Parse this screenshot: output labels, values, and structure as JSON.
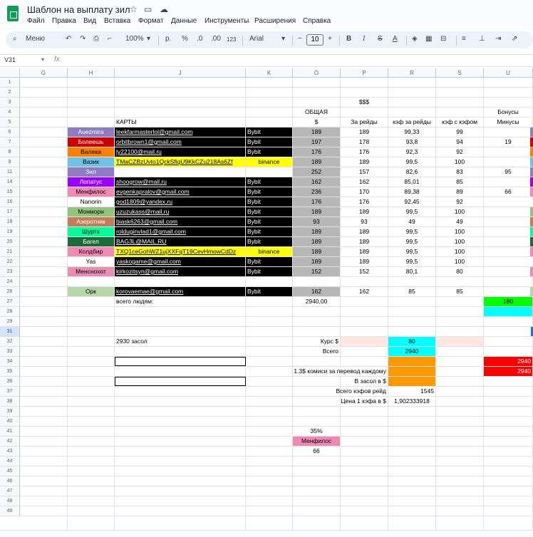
{
  "app": {
    "title": "Шаблон на выплату зил",
    "menus": [
      "Файл",
      "Правка",
      "Вид",
      "Вставка",
      "Формат",
      "Данные",
      "Инструменты",
      "Расширения",
      "Справка"
    ]
  },
  "toolbar": {
    "search_label": "Меню",
    "zoom": "100%",
    "currency": "р.",
    "percent": "%",
    "dec_less": ".0",
    "dec_more": ".00",
    "number_format": "123",
    "font": "Arial",
    "font_size": "10",
    "bold": "B",
    "italic": "I",
    "strike": "S",
    "text_color": "A",
    "minus": "−",
    "plus": "+"
  },
  "formula_bar": {
    "cell_ref": "V31",
    "fx": "fx"
  },
  "columns": [
    "",
    "G",
    "H",
    "J",
    "K",
    "O",
    "P",
    "R",
    "S",
    "U"
  ],
  "rows": [
    "1",
    "2",
    "3",
    "4",
    "5",
    "6",
    "7",
    "8",
    "9",
    "11",
    "14",
    "15",
    "16",
    "17",
    "18",
    "19",
    "20",
    "21",
    "22",
    "23",
    "24",
    "26",
    "27",
    "28",
    "29",
    "31",
    "32",
    "33",
    "34",
    "35",
    "36",
    "37",
    "38",
    "39",
    "40",
    "41",
    "42",
    "43",
    "44",
    "45",
    "46",
    "47",
    "48",
    "49"
  ],
  "headers": {
    "sss": "$$$",
    "obshaya": "ОБЩАЯ",
    "dollar": "$",
    "bonusy": "Бонусы",
    "karty": "КАРТЫ",
    "za_reidy": "За рейды",
    "kef_za_reidy": "кэф за рейды",
    "kef_s_kefom": "кэф с кэфом",
    "minusy": "Минусы"
  },
  "players": [
    {
      "name": "Auezmira",
      "color": "#8e7cc3",
      "text": "#ffffff",
      "card": "leekfarmasterlol@gmail.com",
      "bank": "Bybit",
      "total": "189",
      "raids": "189",
      "kef": "99,33",
      "kef2": "99",
      "minus": "",
      "cardbg": "#000000",
      "cardfg": "#ffffff",
      "ubg": "#8e7cc3"
    },
    {
      "name": "Болеешь",
      "color": "#cc0000",
      "text": "#ffffff",
      "card": "orbitbrown1@gmail.com",
      "bank": "Bybit",
      "total": "197",
      "raids": "178",
      "kef": "93,8",
      "kef2": "94",
      "minus": "19",
      "cardbg": "#000000",
      "cardfg": "#ffffff",
      "ubg": "#cc0000"
    },
    {
      "name": "Валека",
      "color": "#ff7f00",
      "text": "#000000",
      "card": "ly22100@mail.ru",
      "bank": "Bybit",
      "total": "176",
      "raids": "176",
      "kef": "92,3",
      "kef2": "92",
      "minus": "",
      "cardbg": "#000000",
      "cardfg": "#ffffff",
      "ubg": "#ff7f00"
    },
    {
      "name": "Вазик",
      "color": "#6fc1e8",
      "text": "#000000",
      "card": "TMaCZBzUvto1QckSfiqU9KkCZu218As6Zf",
      "bank": "binance",
      "total": "189",
      "raids": "189",
      "kef": "99,5",
      "kef2": "100",
      "minus": "",
      "cardbg": "#ffff00",
      "cardfg": "#000000",
      "ubg": "#6fc1e8"
    },
    {
      "name": "Зил",
      "color": "#8e7cc3",
      "text": "#ffffff",
      "card": "",
      "bank": "",
      "total": "252",
      "raids": "157",
      "kef": "82,6",
      "kef2": "83",
      "minus": "95",
      "cardbg": "#ffffff",
      "cardfg": "#000000",
      "ubg": "#8e7cc3"
    },
    {
      "name": "Лопатус",
      "color": "#9900ff",
      "text": "#ffffff",
      "card": "shoogrow@mail.ru",
      "bank": "Bybit",
      "total": "162",
      "raids": "162",
      "kef": "85,01",
      "kef2": "85",
      "minus": "",
      "cardbg": "#000000",
      "cardfg": "#ffffff",
      "ubg": "#9900ff"
    },
    {
      "name": "Менфилос",
      "color": "#f08ab4",
      "text": "#000000",
      "card": "evgenkapralov@gmail.com",
      "bank": "Bybit",
      "total": "236",
      "raids": "170",
      "kef": "89,38",
      "kef2": "89",
      "minus": "66",
      "cardbg": "#000000",
      "cardfg": "#ffffff",
      "ubg": "#f08ab4"
    },
    {
      "name": "Nanorin",
      "color": "#ffffff",
      "text": "#000000",
      "card": "god1809@yandex.ru",
      "bank": "Bybit",
      "total": "176",
      "raids": "176",
      "kef": "92,45",
      "kef2": "92",
      "minus": "",
      "cardbg": "#000000",
      "cardfg": "#ffffff",
      "ubg": "#ffffff"
    },
    {
      "name": "Монморн",
      "color": "#93c47d",
      "text": "#000000",
      "card": "uzuzukass@mail.ru",
      "bank": "Bybit",
      "total": "189",
      "raids": "189",
      "kef": "99,5",
      "kef2": "100",
      "minus": "",
      "cardbg": "#000000",
      "cardfg": "#ffffff",
      "ubg": "#93c47d"
    },
    {
      "name": "Азеротник",
      "color": "#c27c57",
      "text": "#ffffff",
      "card": "biask6263@gmail.com",
      "bank": "Bybit",
      "total": "93",
      "raids": "93",
      "kef": "49",
      "kef2": "49",
      "minus": "",
      "cardbg": "#000000",
      "cardfg": "#ffffff",
      "ubg": "#c27c57"
    },
    {
      "name": "Шуртх",
      "color": "#00ff99",
      "text": "#000000",
      "card": "rolduginvlad1@gmail.com",
      "bank": "Bybit",
      "total": "189",
      "raids": "189",
      "kef": "99,5",
      "kef2": "100",
      "minus": "",
      "cardbg": "#000000",
      "cardfg": "#ffffff",
      "ubg": "#00ff99"
    },
    {
      "name": "Багел",
      "color": "#1b6b3a",
      "text": "#ffffff",
      "card": "BAG3L@MAIL.RU",
      "bank": "Bybit",
      "total": "189",
      "raids": "189",
      "kef": "99,5",
      "kef2": "100",
      "minus": "",
      "cardbg": "#000000",
      "cardfg": "#ffffff",
      "ubg": "#1b6b3a"
    },
    {
      "name": "Колдбир",
      "color": "#f08ab4",
      "text": "#000000",
      "card": "TXQ1ceGohWZ1ujXXFqT19CevHmowCdDz",
      "bank": "binance",
      "total": "189",
      "raids": "189",
      "kef": "99,5",
      "kef2": "100",
      "minus": "",
      "cardbg": "#ffff00",
      "cardfg": "#000000",
      "ubg": "#f08ab4"
    },
    {
      "name": "Yas",
      "color": "#ffffff",
      "text": "#000000",
      "card": "yaskogame@gmail.com",
      "bank": "Bybit",
      "total": "189",
      "raids": "189",
      "kef": "99,5",
      "kef2": "100",
      "minus": "",
      "cardbg": "#000000",
      "cardfg": "#ffffff",
      "ubg": "#ffffff"
    },
    {
      "name": "Менснохот",
      "color": "#e78fb3",
      "text": "#000000",
      "card": "kirkozitsyn@gmail.com",
      "bank": "Bybit",
      "total": "152",
      "raids": "152",
      "kef": "80,1",
      "kef2": "80",
      "minus": "",
      "cardbg": "#000000",
      "cardfg": "#ffffff",
      "ubg": "#e78fb3"
    },
    {
      "name": "Орк",
      "color": "#b6d7a8",
      "text": "#000000",
      "card": "korovaemae@gmail.com",
      "bank": "Bybit",
      "total": "162",
      "raids": "162",
      "kef": "85",
      "kef2": "85",
      "minus": "",
      "cardbg": "#000000",
      "cardfg": "#ffffff",
      "ubg": "#b6d7a8"
    }
  ],
  "summary": {
    "vsego_lyudyam": "всего людям:",
    "total_sum": "2940,00",
    "bonus_180": "180",
    "zasol_label": "2930 засол",
    "kurs_label": "Курс $",
    "kurs_value": "80",
    "vsego_label": "Всего",
    "vsego_value": "2940",
    "u34": "2940",
    "u35": "2940",
    "komissii": "1.3$ комиси за перевод каждому",
    "v_zasol": "В засол в $",
    "vsego_kefov": "Всего кэфов  рейд",
    "vsego_kefov_value": "1545",
    "cena_kefa": "Цена 1 кэфа в $",
    "cena_kefa_value": "1,902333918",
    "pct": "35%",
    "menfilos": "Менфилос",
    "n66": "66"
  }
}
